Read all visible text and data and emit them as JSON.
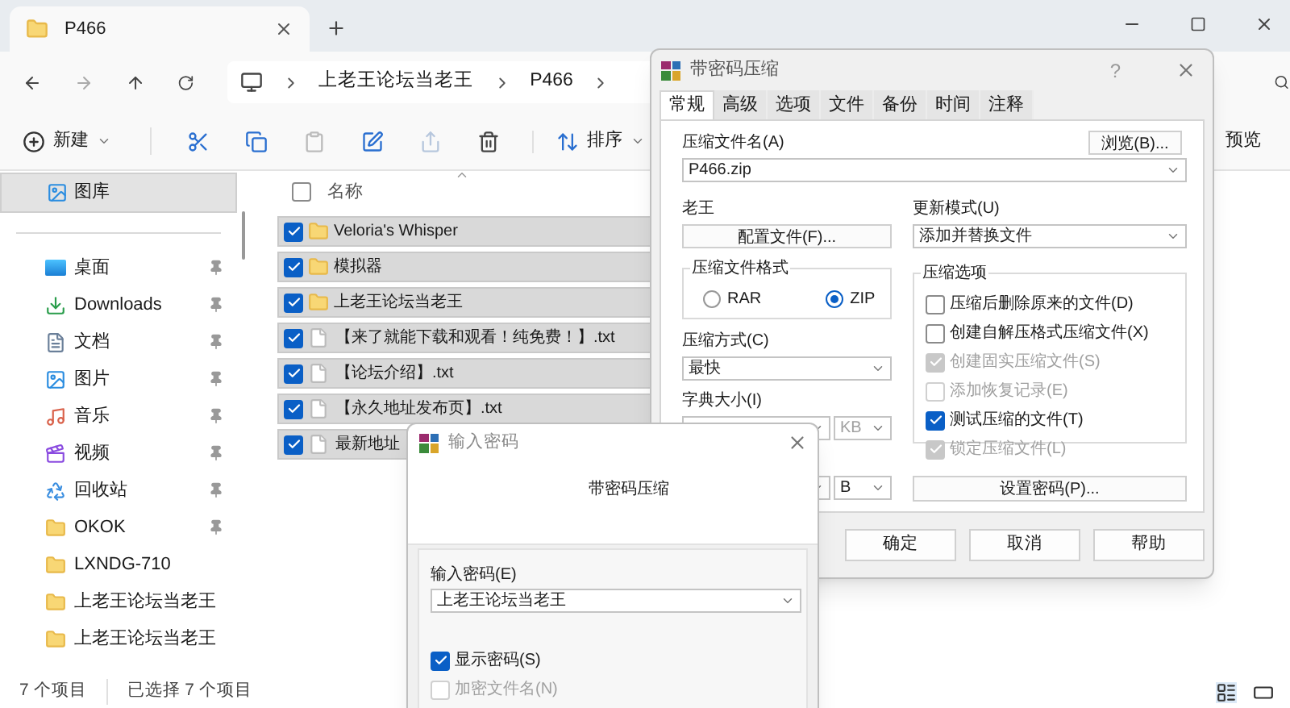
{
  "explorer": {
    "tab_title": "P466",
    "breadcrumbs": [
      "上老王论坛当老王",
      "P466"
    ],
    "toolbar": {
      "new": "新建",
      "sort": "排序",
      "preview": "预览"
    },
    "sidebar": {
      "top": {
        "label": "图库",
        "selected": true
      },
      "items": [
        {
          "kind": "desktop",
          "label": "桌面",
          "pinned": true
        },
        {
          "kind": "download",
          "label": "Downloads",
          "pinned": true
        },
        {
          "kind": "docs",
          "label": "文档",
          "pinned": true
        },
        {
          "kind": "pictures",
          "label": "图片",
          "pinned": true
        },
        {
          "kind": "music",
          "label": "音乐",
          "pinned": true
        },
        {
          "kind": "video",
          "label": "视频",
          "pinned": true
        },
        {
          "kind": "recycle",
          "label": "回收站",
          "pinned": true
        },
        {
          "kind": "folder",
          "label": "OKOK",
          "pinned": true
        },
        {
          "kind": "folder",
          "label": "LXNDG-710",
          "pinned": false
        },
        {
          "kind": "folder",
          "label": "上老王论坛当老王",
          "pinned": false
        },
        {
          "kind": "folder",
          "label": "上老王论坛当老王",
          "pinned": false
        }
      ]
    },
    "select_all": {
      "checked": false
    },
    "column_header": "名称",
    "files": [
      {
        "kind": "folder",
        "name": "Veloria's Whisper",
        "selected": true
      },
      {
        "kind": "folder",
        "name": "模拟器",
        "selected": true
      },
      {
        "kind": "folder",
        "name": "上老王论坛当老王",
        "selected": true
      },
      {
        "kind": "file",
        "name": "【来了就能下载和观看！纯免费！】.txt",
        "selected": true
      },
      {
        "kind": "file",
        "name": "【论坛介绍】.txt",
        "selected": true
      },
      {
        "kind": "file",
        "name": "【永久地址发布页】.txt",
        "selected": true
      },
      {
        "kind": "file",
        "name": "最新地址",
        "selected": true
      }
    ],
    "status_bar": {
      "count": "7 个项目",
      "selection": "已选择 7 个项目"
    }
  },
  "archive_dialog": {
    "title": "带密码压缩",
    "help": "?",
    "tabs": [
      {
        "label": "常规",
        "selected": true
      },
      {
        "label": "高级",
        "selected": false
      },
      {
        "label": "选项",
        "selected": false
      },
      {
        "label": "文件",
        "selected": false
      },
      {
        "label": "备份",
        "selected": false
      },
      {
        "label": "时间",
        "selected": false
      },
      {
        "label": "注释",
        "selected": false
      }
    ],
    "archive_name_label": "压缩文件名(A)",
    "browse_button": "浏览(B)...",
    "archive_name": "P466.zip",
    "profile_label": "老王",
    "profile_button": "配置文件(F)...",
    "update_mode_label": "更新模式(U)",
    "update_mode": "添加并替换文件",
    "format_label": "压缩文件格式",
    "formats": [
      {
        "label": "RAR",
        "selected": false
      },
      {
        "label": "ZIP",
        "selected": true
      }
    ],
    "method_label": "压缩方式(C)",
    "method": "最快",
    "dictionary_label": "字典大小(I)",
    "dictionary_unit": "KB",
    "word_unit": "B",
    "options_label": "压缩选项",
    "options": [
      {
        "label": "压缩后删除原来的文件(D)",
        "checked": false,
        "disabled": false
      },
      {
        "label": "创建自解压格式压缩文件(X)",
        "checked": false,
        "disabled": false
      },
      {
        "label": "创建固实压缩文件(S)",
        "checked": true,
        "disabled": true
      },
      {
        "label": "添加恢复记录(E)",
        "checked": false,
        "disabled": true
      },
      {
        "label": "测试压缩的文件(T)",
        "checked": true,
        "disabled": false
      },
      {
        "label": "锁定压缩文件(L)",
        "checked": true,
        "disabled": true
      }
    ],
    "password_button": "设置密码(P)...",
    "buttons": [
      "确定",
      "取消",
      "帮助"
    ]
  },
  "password_dialog": {
    "title": "输入密码",
    "header": "带密码压缩",
    "field_label": "输入密码(E)",
    "password": "上老王论坛当老王",
    "options": [
      {
        "label": "显示密码(S)",
        "checked": true,
        "disabled": false
      },
      {
        "label": "加密文件名(N)",
        "checked": false,
        "disabled": true
      }
    ]
  }
}
